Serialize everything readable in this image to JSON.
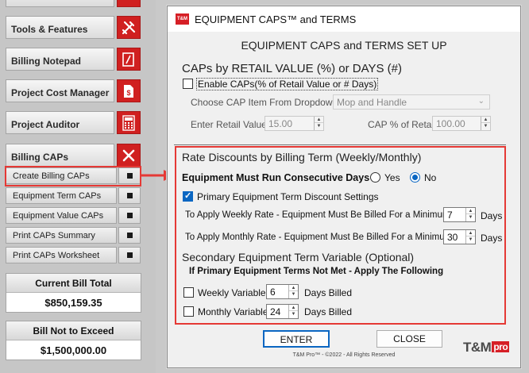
{
  "sidebar": {
    "items": [
      {
        "label": "Tools & Features",
        "icon": "tools-icon"
      },
      {
        "label": "Billing Notepad",
        "icon": "notepad-icon"
      },
      {
        "label": "Project Cost Manager",
        "icon": "cost-manager-icon"
      },
      {
        "label": "Project Auditor",
        "icon": "calculator-icon"
      },
      {
        "label": "Billing CAPs",
        "icon": "close-icon"
      }
    ],
    "sub_items": [
      {
        "label": "Create Billing CAPs"
      },
      {
        "label": "Equipment Term CAPs"
      },
      {
        "label": "Equipment Value CAPs"
      },
      {
        "label": "Print CAPs Summary"
      },
      {
        "label": "Print CAPs Worksheet"
      }
    ],
    "current_bill": {
      "label": "Current Bill Total",
      "value": "$850,159.35"
    },
    "not_to_exceed": {
      "label": "Bill Not to Exceed",
      "value": "$1,500,000.00"
    }
  },
  "dialog": {
    "app_logo": "T&M",
    "title": "EQUIPMENT CAPS™ and TERMS",
    "heading": "EQUIPMENT CAPS and TERMS SET UP",
    "caps": {
      "heading": "CAPs by RETAIL VALUE (%) or  DAYS (#)",
      "enable_label": "Enable CAPs(% of Retail Value or # Days)",
      "choose_label": "Choose CAP Item From Dropdown",
      "dropdown_value": "Mop  and Handle",
      "retail_label": "Enter Retail Value",
      "retail_value": "15.00",
      "cap_pct_label": "CAP % of Retail",
      "cap_pct_value": "100.00"
    },
    "rate": {
      "heading": "Rate Discounts by Billing Term (Weekly/Monthly)",
      "consecutive_label": "Equipment Must Run Consecutive Days",
      "yes_label": "Yes",
      "no_label": "No",
      "primary_label": "Primary Equipment Term Discount Settings",
      "weekly_label": "To Apply Weekly Rate - Equipment Must Be Billed For a Minimum of",
      "weekly_value": "7",
      "monthly_label": "To Apply Monthly Rate - Equipment Must Be Billed For a Minimum of",
      "monthly_value": "30",
      "days_label": "Days",
      "secondary_heading": "Secondary Equipment Term Variable (Optional)",
      "secondary_sub": "If Primary Equipment Terms Not Met - Apply The Following",
      "weekly_var_label": "Weekly Variable",
      "weekly_var_value": "6",
      "monthly_var_label": "Monthly Variable",
      "monthly_var_value": "24",
      "days_billed_label": "Days Billed"
    },
    "enter_label": "ENTER",
    "close_label": "CLOSE",
    "footer": "T&M Pro™ - ©2022 - All Rights Reserved",
    "brand": "T&M",
    "brand_badge": "pro"
  },
  "colors": {
    "accent_red": "#d02020",
    "highlight": "#e53935",
    "focus_blue": "#0a66c2"
  }
}
